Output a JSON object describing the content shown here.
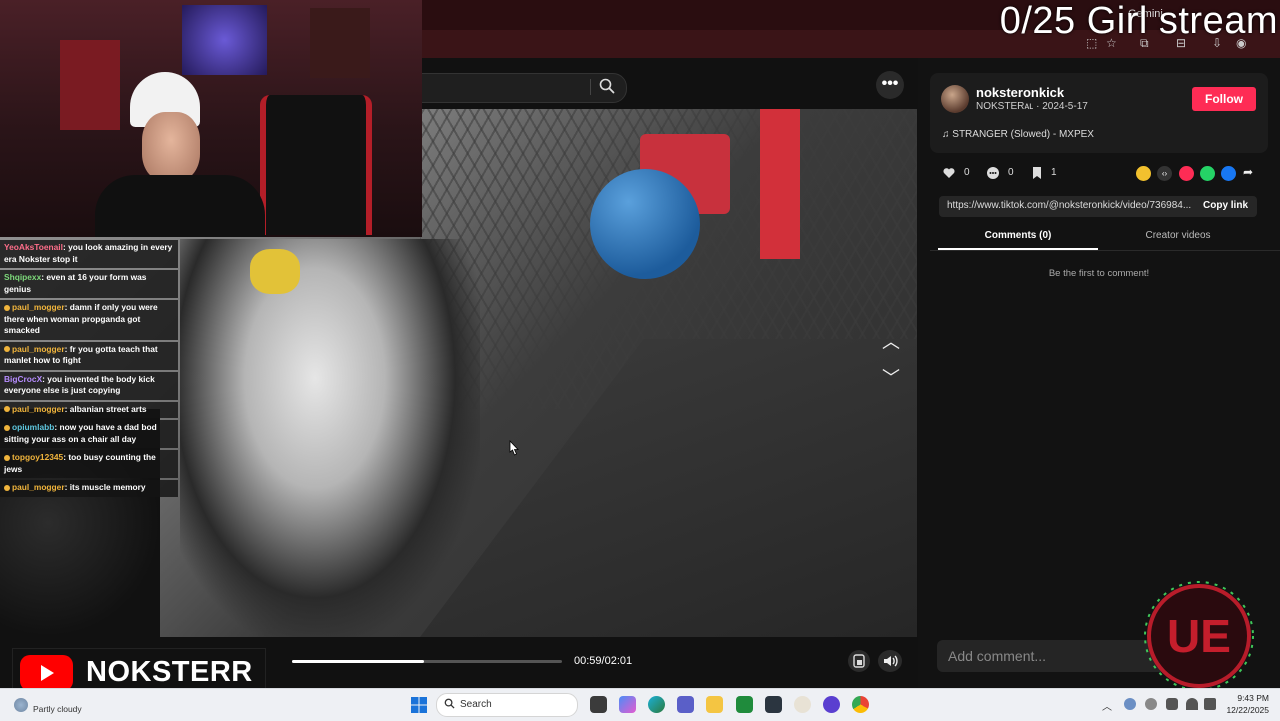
{
  "overlay": {
    "title": "0/25 Girl stream"
  },
  "browser": {
    "profile_label": "Gemini"
  },
  "video_page": {
    "search_placeholder": "",
    "more_label": "•••",
    "nav_up_glyph": "︿",
    "nav_down_glyph": "﹀",
    "elapsed": "00:59",
    "duration": "02:01",
    "time_label": "00:59/02:01",
    "progress_fraction": 0.49
  },
  "sidebar": {
    "author": {
      "name": "noksteronkick",
      "subtitle": "NOKSTERᴀʟ · 2024-5-17"
    },
    "follow_label": "Follow",
    "music": "STRANGER (Slowed) - MXPEX",
    "stats": {
      "likes": "0",
      "comments": "0",
      "saves": "1"
    },
    "link_url": "https://www.tiktok.com/@noksteronkick/video/736984...",
    "copy_link_label": "Copy link",
    "tabs": {
      "comments": "Comments (0)",
      "creator": "Creator videos"
    },
    "empty_comments": "Be the first to comment!",
    "comment_placeholder": "Add comment..."
  },
  "chat": [
    {
      "user": "YeoAksToenail",
      "user_color": "#ff6e8a",
      "badge": "",
      "text": ": you look amazing in every era Nokster stop it"
    },
    {
      "user": "Shqipexx",
      "user_color": "#7dd87a",
      "badge": "",
      "text": ": even at 16 your form was genius"
    },
    {
      "user": "paul_mogger",
      "user_color": "#f0b43c",
      "badge": "#f0b43c",
      "text": ": damn if only you were there when woman propganda got smacked"
    },
    {
      "user": "paul_mogger",
      "user_color": "#f0b43c",
      "badge": "#f0b43c",
      "text": ": fr you gotta teach that manlet how to fight"
    },
    {
      "user": "BigCrocX",
      "user_color": "#b68cff",
      "badge": "",
      "text": ": you invented the body kick everyone else is just copying"
    },
    {
      "user": "paul_mogger",
      "user_color": "#f0b43c",
      "badge": "#f0b43c",
      "text": ": albanian street arts"
    },
    {
      "user": "opiumlabb",
      "user_color": "#5ec8e0",
      "badge": "#f0b43c",
      "text": ": now you have a dad bod sitting your ass on a chair all day"
    },
    {
      "user": "topgoy12345",
      "user_color": "#f0b43c",
      "badge": "#f0b43c",
      "text": ": too busy counting the jews"
    },
    {
      "user": "paul_mogger",
      "user_color": "#f0b43c",
      "badge": "#f0b43c",
      "text": ": its muscle memory"
    }
  ],
  "youtube_banner": {
    "name": "NOKSTERR"
  },
  "taskbar": {
    "weather": "Partly cloudy",
    "search_label": "Search",
    "time": "9:43 PM",
    "date": "12/22/2025"
  },
  "colors": {
    "accent": "#fe2c55",
    "youtube": "#ff0000",
    "browser_bar": "#3a1417"
  }
}
